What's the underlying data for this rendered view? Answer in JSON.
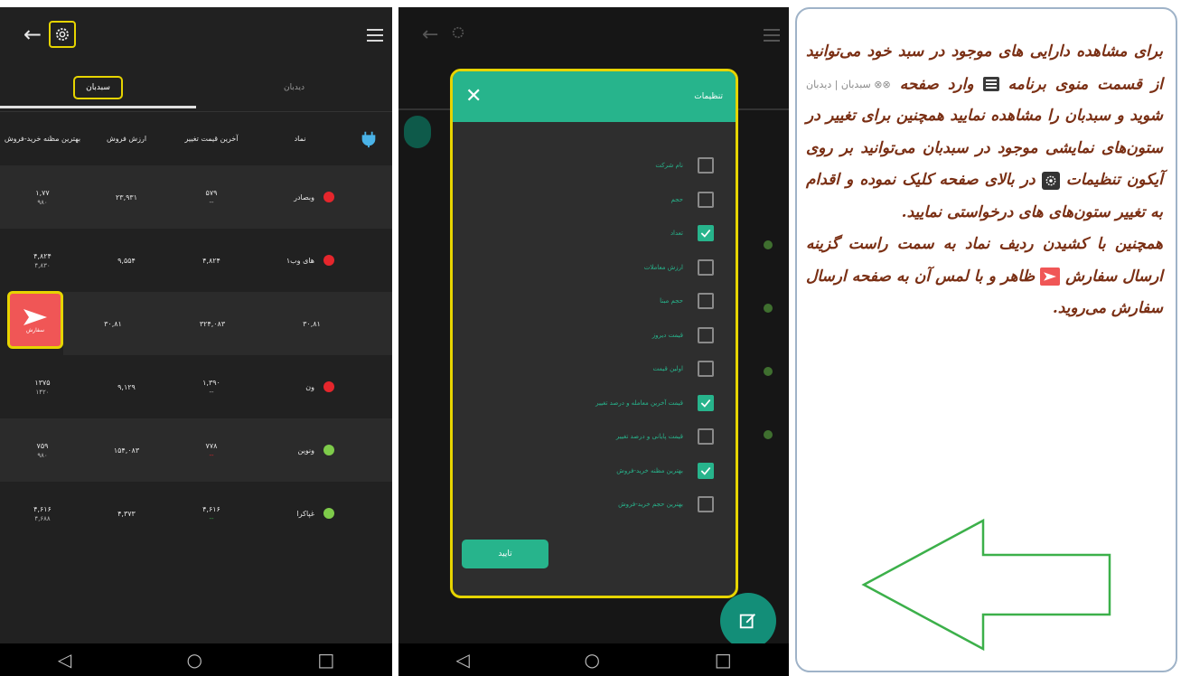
{
  "screen1": {
    "tabs": [
      "سبدبان",
      "دیدبان"
    ],
    "columns": [
      "نماد",
      "آخرین قیمت تغییر",
      "ارزش فروش",
      "بهترین مظنه خرید-فروش"
    ],
    "rows": [
      {
        "symbol": "وبصادر",
        "last": "۵۷۹",
        "last_sub": "--",
        "value": "۲۳,۹۳۱",
        "best": "۱,۷۷",
        "best_sub": "۹۸۰",
        "status": "red"
      },
      {
        "symbol": "های وب۱",
        "last": "۴,۸۲۴",
        "last_sub": "",
        "value": "۹,۵۵۴",
        "best": "۴,۸۲۴",
        "best_sub": "۴,۸۳۰",
        "status": "red"
      },
      {
        "symbol": "",
        "last": "۳۰,۸۱",
        "last_sub": "",
        "value": "۳۲۴,۰۸۳",
        "best": "۳۰,۸۱",
        "best_sub": "",
        "status": ""
      },
      {
        "symbol": "ون",
        "last": "۱,۳۹۰",
        "last_sub": "--",
        "value": "۹,۱۲۹",
        "best": "۱۳۷۵",
        "best_sub": "۱۴۲۰",
        "status": "red"
      },
      {
        "symbol": "ونوین",
        "last": "۷۷۸",
        "last_sub": "--",
        "value": "۱۵۴,۰۸۳",
        "best": "۷۵۹",
        "best_sub": "۹۸۰",
        "status": "green"
      },
      {
        "symbol": "غپاکرا",
        "last": "۴,۶۱۶",
        "last_sub": "--",
        "value": "۴,۳۷۳",
        "best": "۴,۶۱۶",
        "best_sub": "۴,۶۸۸",
        "status": "green"
      }
    ],
    "send_label": "سفارش"
  },
  "screen2": {
    "dialog_title": "تنظیمات",
    "options": [
      {
        "label": "نام شرکت",
        "checked": false
      },
      {
        "label": "حجم",
        "checked": false
      },
      {
        "label": "تعداد",
        "checked": true
      },
      {
        "label": "ارزش معاملات",
        "checked": false
      },
      {
        "label": "حجم مبنا",
        "checked": false
      },
      {
        "label": "قیمت دیروز",
        "checked": false
      },
      {
        "label": "اولین قیمت",
        "checked": false
      },
      {
        "label": "قیمت آخرین معامله و درصد تغییر",
        "checked": true
      },
      {
        "label": "قیمت پایانی و درصد تغییر",
        "checked": false
      },
      {
        "label": "بهترین مظنه خرید-فروش",
        "checked": true
      },
      {
        "label": "بهترین حجم خرید-فروش",
        "checked": false
      }
    ],
    "confirm_label": "تایید"
  },
  "instructions": {
    "p1a": "برای مشاهده دارایی های موجود در سبد خود می‌توانید از قسمت منوی برنامه",
    "p1b": "وارد صفحه",
    "tabs_inline": "سبدبان | دیدبان",
    "p1c": "شوید و سبدبان را مشاهده نمایید همچنین برای تغییر در ستون‌های نمایشی موجود در سبدبان می‌توانید بر روی آیکون تنظیمات",
    "p1d": "در بالای صفحه کلیک نموده و اقدام به تغییر ستون‌های های درخواستی نمایید.",
    "p2a": "همچنین با کشیدن ردیف نماد به سمت راست گزینه ارسال سفارش",
    "p2b": "ظاهر و با لمس آن به صفحه ارسال سفارش می‌روید."
  },
  "colors": {
    "teal": "#27b48c",
    "highlight": "#e6d400",
    "send": "#f05656",
    "instruction_text": "#7a2f14",
    "arrow": "#3cb04a"
  }
}
